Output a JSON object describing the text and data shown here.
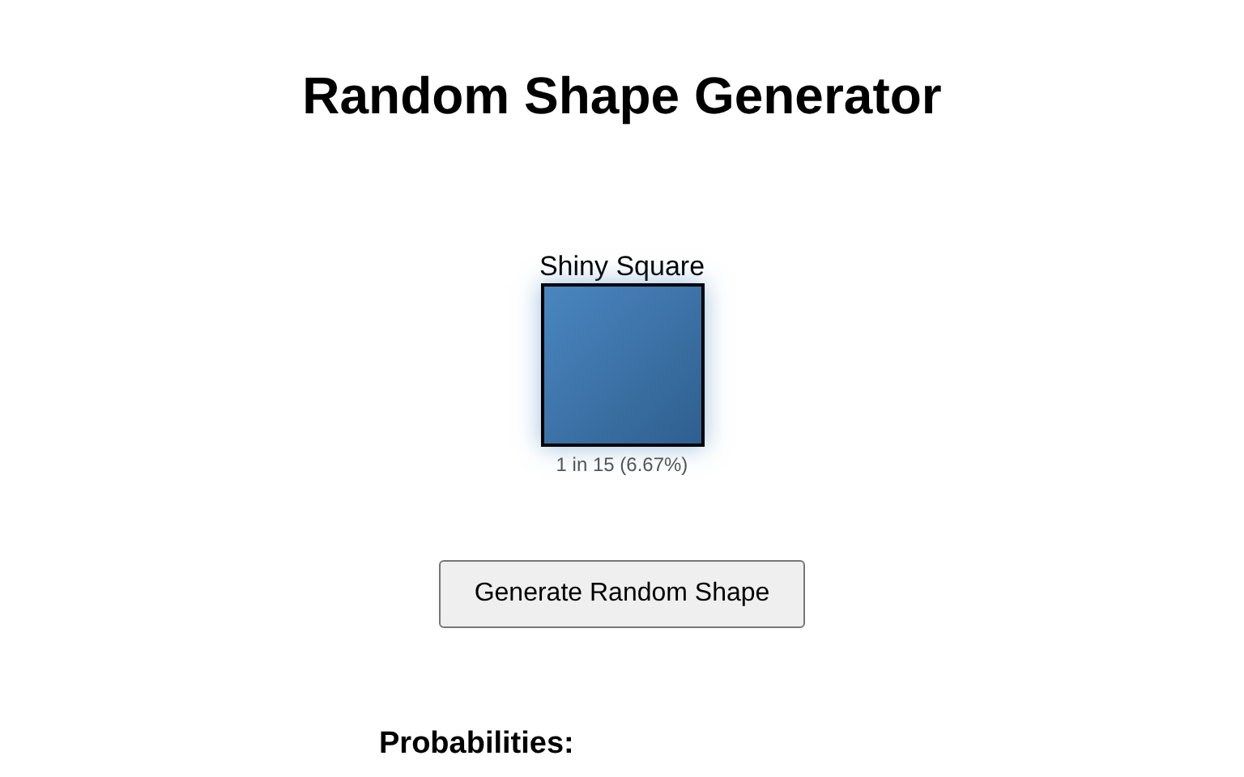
{
  "title": "Random Shape Generator",
  "result": {
    "name": "Shiny Square",
    "kind": "square",
    "color": "#4a86c0",
    "odds": "1 in 15 (6.67%)"
  },
  "button": "Generate Random Shape",
  "probabilities_heading": "Probabilities:"
}
